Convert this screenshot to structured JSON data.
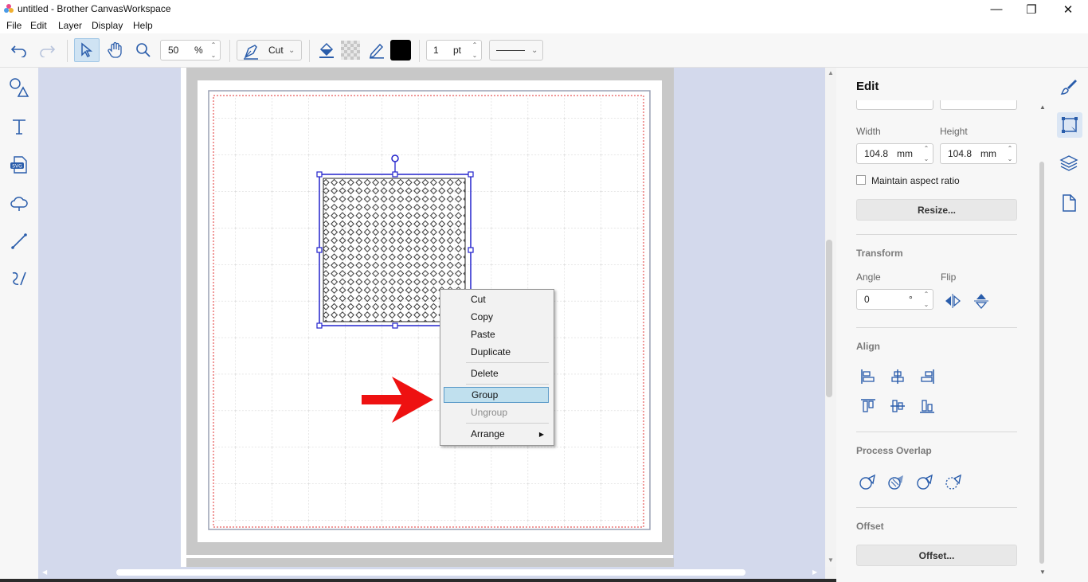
{
  "window": {
    "title": "untitled - Brother CanvasWorkspace",
    "minimize": "—",
    "maximize": "❐",
    "close": "✕"
  },
  "menu": [
    "File",
    "Edit",
    "Layer",
    "Display",
    "Help"
  ],
  "toolbar": {
    "zoom_value": "50",
    "zoom_unit": "%",
    "cut_mode": "Cut",
    "line_width_value": "1",
    "line_width_unit": "pt",
    "line_color": "#000000"
  },
  "context_menu": {
    "items": [
      {
        "label": "Cut",
        "enabled": true
      },
      {
        "label": "Copy",
        "enabled": true
      },
      {
        "label": "Paste",
        "enabled": true
      },
      {
        "label": "Duplicate",
        "enabled": true
      },
      {
        "label": "Delete",
        "enabled": true
      },
      {
        "label": "Group",
        "enabled": true,
        "highlighted": true
      },
      {
        "label": "Ungroup",
        "enabled": false
      },
      {
        "label": "Arrange",
        "enabled": true,
        "has_submenu": true
      }
    ]
  },
  "edit_panel": {
    "title": "Edit",
    "width_label": "Width",
    "height_label": "Height",
    "width_value": "104.8",
    "height_value": "104.8",
    "unit": "mm",
    "maintain_aspect_label": "Maintain aspect ratio",
    "resize_button": "Resize...",
    "transform_section": "Transform",
    "angle_label": "Angle",
    "angle_value": "0",
    "angle_unit": "°",
    "flip_label": "Flip",
    "align_section": "Align",
    "process_overlap_section": "Process Overlap",
    "offset_section": "Offset",
    "offset_button": "Offset..."
  },
  "colors": {
    "accent": "#2a5dab",
    "selection": "#2020c0",
    "highlight": "#bfe0ee",
    "arrow": "#ee1111",
    "canvas_bg": "#d3d9ec"
  }
}
